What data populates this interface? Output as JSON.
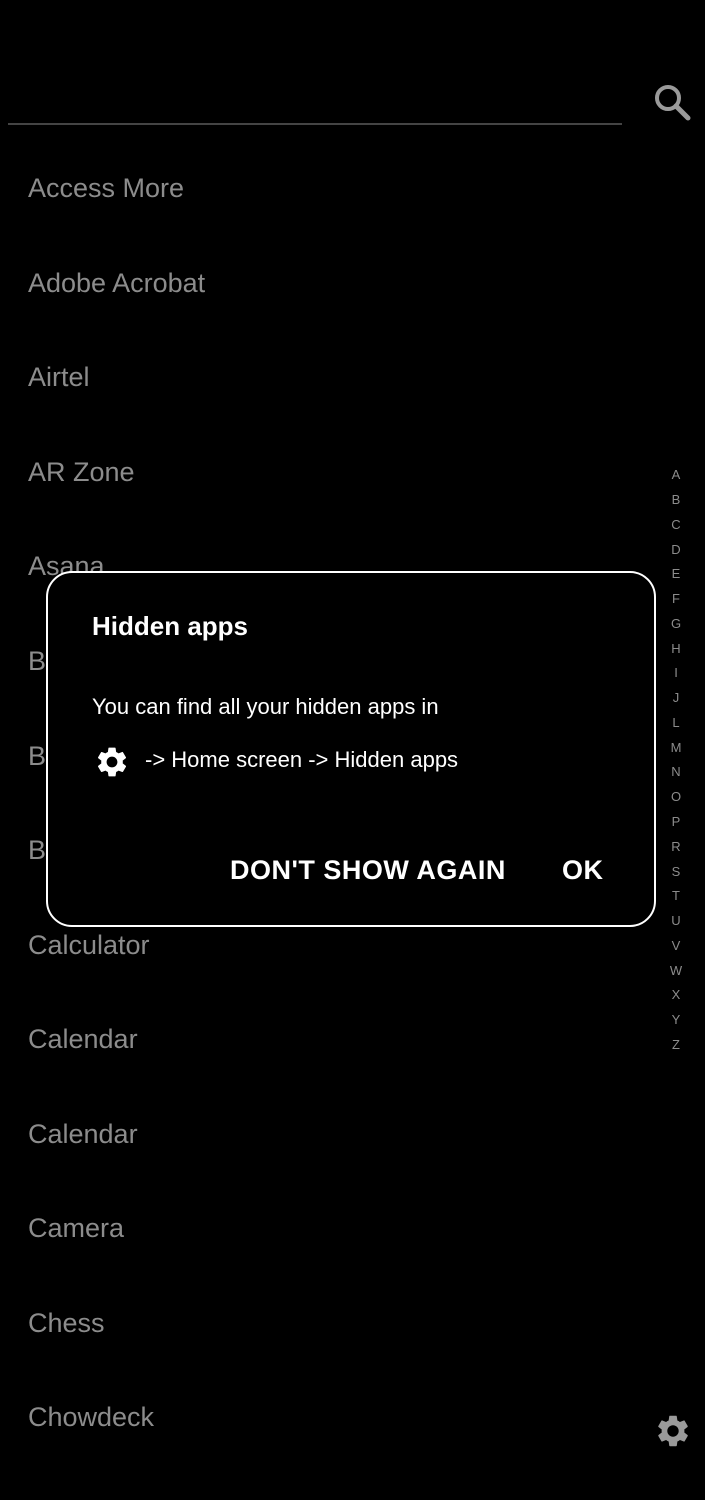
{
  "apps": [
    "Access More",
    "Adobe Acrobat",
    "Airtel",
    "AR Zone",
    "Asana",
    "B",
    "B",
    "B",
    "Calculator",
    "Calendar",
    "Calendar",
    "Camera",
    "Chess",
    "Chowdeck"
  ],
  "alphabet": [
    "A",
    "B",
    "C",
    "D",
    "E",
    "F",
    "G",
    "H",
    "I",
    "J",
    "L",
    "M",
    "N",
    "O",
    "P",
    "R",
    "S",
    "T",
    "U",
    "V",
    "W",
    "X",
    "Y",
    "Z"
  ],
  "icons": {
    "search": "search-icon",
    "settings": "gear-icon"
  },
  "dialog": {
    "title": "Hidden apps",
    "message": "You can find all your hidden apps in",
    "path": "-> Home screen -> Hidden apps",
    "dont_show_label": "DON'T SHOW AGAIN",
    "ok_label": "OK"
  },
  "colors": {
    "background": "#000000",
    "list_text": "#8c8c8c",
    "dialog_border": "#ffffff"
  }
}
